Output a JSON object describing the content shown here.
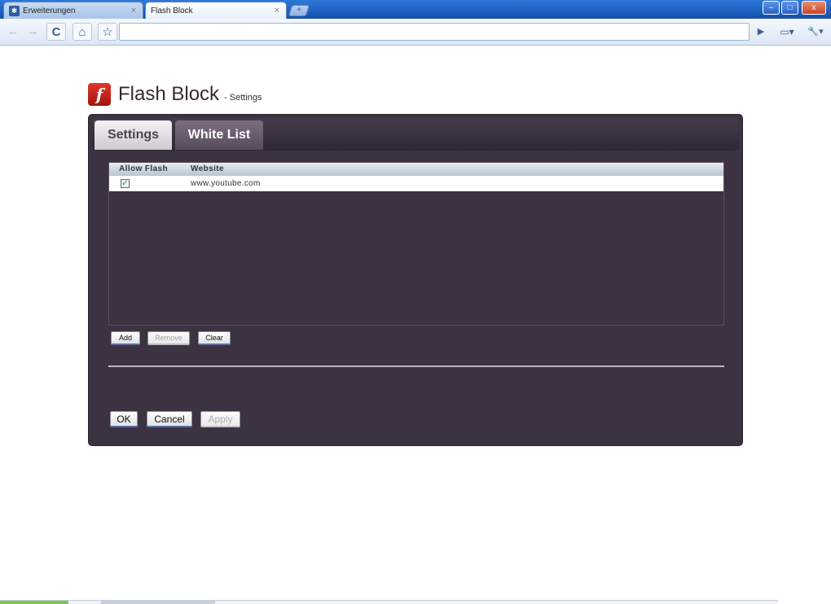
{
  "browser": {
    "tabs": [
      {
        "label": "Erweiterungen",
        "favicon": "puzzle-icon",
        "active": false
      },
      {
        "label": "Flash Block",
        "active": true
      }
    ],
    "new_tab_icon": "+",
    "window_controls": {
      "minimize": "–",
      "maximize": "□",
      "close": "x"
    },
    "toolbar_icons": {
      "back": "←",
      "forward": "→",
      "reload": "C",
      "home": "⌂",
      "star": "☆",
      "go": "▶",
      "page_menu": "▭▾",
      "wrench_menu": "🔧▾"
    },
    "address": ""
  },
  "app": {
    "logo_letter": "f",
    "title": "Flash Block",
    "subtitle": "- Settings"
  },
  "tabs": {
    "settings": "Settings",
    "white_list": "White List"
  },
  "whitelist": {
    "columns": {
      "allow": "Allow Flash",
      "site": "Website"
    },
    "rows": [
      {
        "allow": true,
        "website": "www.youtube.com"
      }
    ],
    "checkmark": "✓"
  },
  "list_buttons": {
    "add": "Add",
    "remove": "Remove",
    "clear": "Clear"
  },
  "dialog_buttons": {
    "ok": "OK",
    "cancel": "Cancel",
    "apply": "Apply"
  },
  "colors": {
    "panel_bg": "#3c3241",
    "active_tab": "#6a5d70",
    "logo_red": "#c8201a",
    "chrome_blue": "#1c5fc0"
  }
}
